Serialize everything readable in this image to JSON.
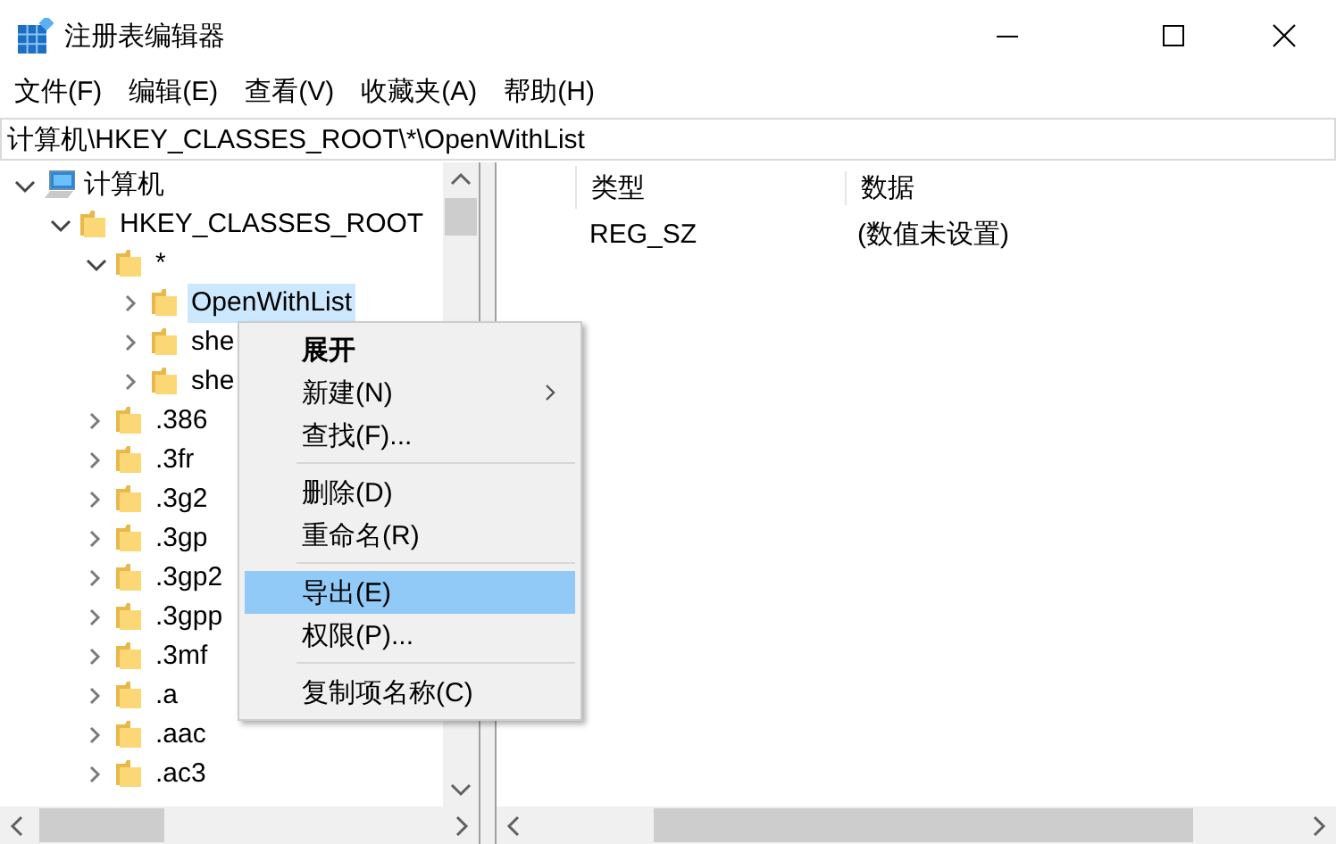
{
  "window": {
    "title": "注册表编辑器"
  },
  "menu_bar": [
    "文件(F)",
    "编辑(E)",
    "查看(V)",
    "收藏夹(A)",
    "帮助(H)"
  ],
  "address": "计算机\\HKEY_CLASSES_ROOT\\*\\OpenWithList",
  "tree": [
    {
      "label": "计算机",
      "kind": "computer",
      "expanded": true,
      "selected": false,
      "children": [
        {
          "label": "HKEY_CLASSES_ROOT",
          "kind": "folder",
          "expanded": true,
          "selected": false,
          "children": [
            {
              "label": "*",
              "kind": "folder",
              "expanded": true,
              "selected": false,
              "children": [
                {
                  "label": "OpenWithList",
                  "kind": "folder",
                  "expanded": false,
                  "selected": true
                },
                {
                  "label": "she",
                  "kind": "folder",
                  "expanded": false,
                  "selected": false
                },
                {
                  "label": "she",
                  "kind": "folder",
                  "expanded": false,
                  "selected": false
                }
              ]
            },
            {
              "label": ".386",
              "kind": "folder",
              "expanded": false,
              "selected": false
            },
            {
              "label": ".3fr",
              "kind": "folder",
              "expanded": false,
              "selected": false
            },
            {
              "label": ".3g2",
              "kind": "folder",
              "expanded": false,
              "selected": false
            },
            {
              "label": ".3gp",
              "kind": "folder",
              "expanded": false,
              "selected": false
            },
            {
              "label": ".3gp2",
              "kind": "folder",
              "expanded": false,
              "selected": false
            },
            {
              "label": ".3gpp",
              "kind": "folder",
              "expanded": false,
              "selected": false
            },
            {
              "label": ".3mf",
              "kind": "folder",
              "expanded": false,
              "selected": false
            },
            {
              "label": ".a",
              "kind": "folder",
              "expanded": false,
              "selected": false
            },
            {
              "label": ".aac",
              "kind": "folder",
              "expanded": false,
              "selected": false
            },
            {
              "label": ".ac3",
              "kind": "folder",
              "expanded": false,
              "selected": false
            }
          ]
        }
      ]
    }
  ],
  "values_list": {
    "columns": [
      "类型",
      "数据"
    ],
    "rows": [
      {
        "type": "REG_SZ",
        "data": "(数值未设置)"
      }
    ]
  },
  "context_menu": [
    {
      "kind": "item",
      "label": "展开",
      "default": true,
      "submenu": false,
      "selected": false
    },
    {
      "kind": "item",
      "label": "新建(N)",
      "default": false,
      "submenu": true,
      "selected": false
    },
    {
      "kind": "item",
      "label": "查找(F)...",
      "default": false,
      "submenu": false,
      "selected": false
    },
    {
      "kind": "separator"
    },
    {
      "kind": "item",
      "label": "删除(D)",
      "default": false,
      "submenu": false,
      "selected": false
    },
    {
      "kind": "item",
      "label": "重命名(R)",
      "default": false,
      "submenu": false,
      "selected": false
    },
    {
      "kind": "separator"
    },
    {
      "kind": "item",
      "label": "导出(E)",
      "default": false,
      "submenu": false,
      "selected": true
    },
    {
      "kind": "item",
      "label": "权限(P)...",
      "default": false,
      "submenu": false,
      "selected": false
    },
    {
      "kind": "separator"
    },
    {
      "kind": "item",
      "label": "复制项名称(C)",
      "default": false,
      "submenu": false,
      "selected": false
    }
  ]
}
